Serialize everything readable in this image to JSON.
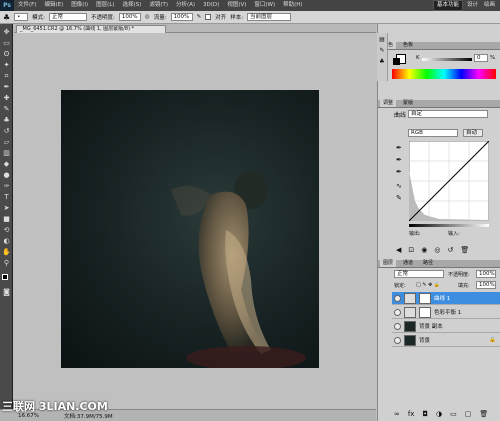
{
  "menubar": {
    "items": [
      "文件(F)",
      "编辑(E)",
      "图像(I)",
      "图层(L)",
      "选择(S)",
      "滤镜(T)",
      "分析(A)",
      "3D(D)",
      "视图(V)",
      "窗口(W)",
      "帮助(H)"
    ],
    "zoom": "16.7",
    "workspace_buttons": [
      "基本功能",
      "设计",
      "绘画"
    ]
  },
  "optionsbar": {
    "mode_label": "模式:",
    "mode_value": "正常",
    "opacity_label": "不透明度:",
    "opacity_value": "100%",
    "flow_label": "流量:",
    "flow_value": "100%",
    "align_label": "对齐",
    "sample_label": "样本:",
    "sample_value": "当前图层"
  },
  "document": {
    "tab_title": "_MG_6451.CR2 @ 16.7% (曲线 1, 图层蒙版/8) *"
  },
  "status": {
    "zoom": "16.67%",
    "doc": "文档:37.9M/75.9M"
  },
  "color_panel": {
    "tabs": [
      "颜色",
      "色板"
    ],
    "k_label": "K",
    "k_value": "0",
    "unit": "%"
  },
  "adjustments": {
    "tabs": [
      "调整",
      "蒙版"
    ],
    "title": "曲线",
    "preset_value": "自定",
    "channel": "RGB",
    "auto_button": "自动",
    "output_label": "输出:",
    "input_label": "输入:"
  },
  "layers_panel": {
    "tabs": [
      "图层",
      "通道",
      "路径"
    ],
    "blend_mode": "正常",
    "opacity_label": "不透明度:",
    "opacity_value": "100%",
    "lock_label": "锁定:",
    "fill_label": "填充:",
    "fill_value": "100%",
    "layers": [
      {
        "name": "曲线 1",
        "selected": true
      },
      {
        "name": "色彩平衡 1",
        "selected": false
      },
      {
        "name": "背景 副本",
        "selected": false
      },
      {
        "name": "背景",
        "selected": false
      }
    ]
  },
  "watermark": "三联网 3LIAN.COM"
}
